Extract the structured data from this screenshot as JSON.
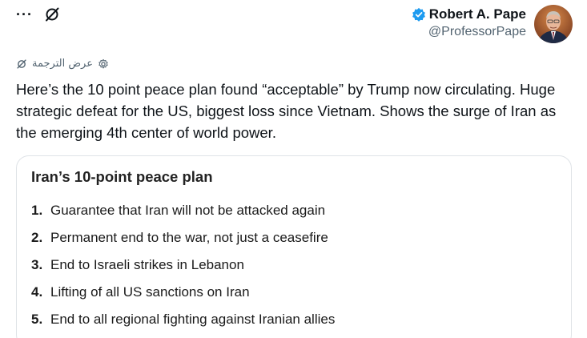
{
  "author": {
    "name": "Robert A. Pape",
    "handle": "@ProfessorPape"
  },
  "header_icons": [
    "more-icon",
    "grok-icon",
    "verified-icon"
  ],
  "more_label": "···",
  "translate_label": "عرض الترجمة",
  "tweet_text": "Here’s the 10 point peace plan found “acceptable” by Trump now circulating.  Huge strategic defeat for the US, biggest loss since Vietnam. Shows the surge of Iran as the emerging 4th center of world power.",
  "card": {
    "title": "Iran’s 10-point peace plan",
    "items": [
      {
        "num": "1.",
        "text": "Guarantee that Iran will not be attacked again"
      },
      {
        "num": "2.",
        "text": "Permanent end to the war, not just a ceasefire"
      },
      {
        "num": "3.",
        "text": "End to Israeli strikes in Lebanon"
      },
      {
        "num": "4.",
        "text": "Lifting of all US sanctions on Iran"
      },
      {
        "num": "5.",
        "text": "End to all regional fighting against Iranian allies"
      }
    ]
  },
  "colors": {
    "verified": "#1d9bf0",
    "secondary_text": "#536471",
    "card_border": "#dfe3e7"
  }
}
